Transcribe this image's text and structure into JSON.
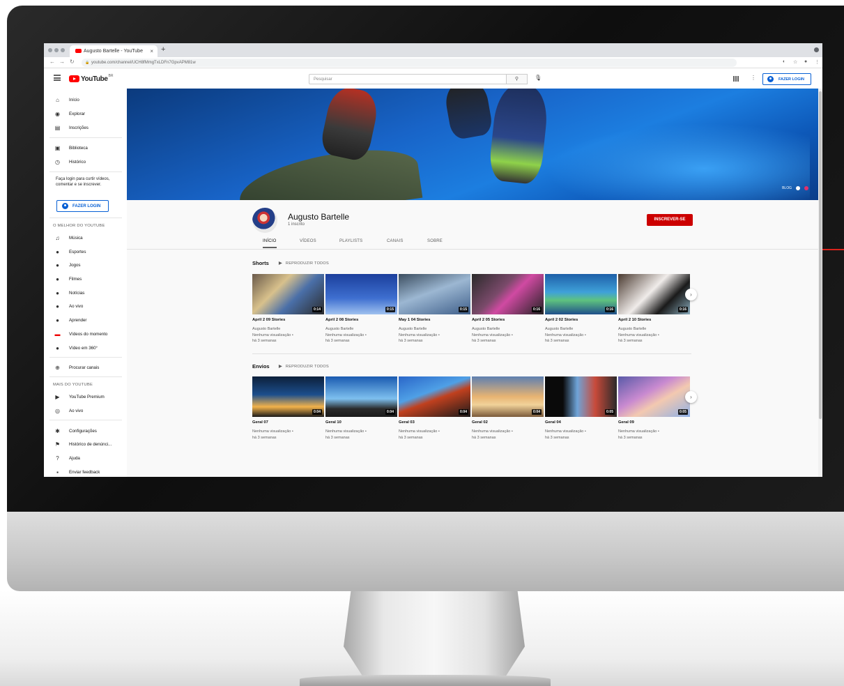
{
  "browser": {
    "tab_title": "Augusto Bartelle - YouTube",
    "tab_close": "×",
    "new_tab": "+",
    "url": "youtube.com/channel/UCH8fMmgTxLDFn7GpvAPM81w"
  },
  "header": {
    "logo_text": "YouTube",
    "logo_country": "BR",
    "search_placeholder": "Pesquisar",
    "login_label": "FAZER LOGIN"
  },
  "sidebar": {
    "main_items": [
      {
        "label": "Início",
        "icon": "home-icon"
      },
      {
        "label": "Explorar",
        "icon": "compass-icon"
      },
      {
        "label": "Inscrições",
        "icon": "subscriptions-icon"
      }
    ],
    "library_items": [
      {
        "label": "Biblioteca",
        "icon": "library-icon"
      },
      {
        "label": "Histórico",
        "icon": "history-icon"
      }
    ],
    "login_prompt": "Faça login para curtir vídeos, comentar e se inscrever.",
    "login_label": "FAZER LOGIN",
    "best_heading": "O MELHOR DO YOUTUBE",
    "best_items": [
      {
        "label": "Música",
        "icon": "music-icon"
      },
      {
        "label": "Esportes",
        "icon": "trophy-icon"
      },
      {
        "label": "Jogos",
        "icon": "gamepad-icon"
      },
      {
        "label": "Filmes",
        "icon": "film-icon"
      },
      {
        "label": "Notícias",
        "icon": "news-icon"
      },
      {
        "label": "Ao vivo",
        "icon": "live-icon"
      },
      {
        "label": "Aprender",
        "icon": "bulb-icon"
      },
      {
        "label": "Vídeos do momento",
        "icon": "trending-icon"
      },
      {
        "label": "Vídeo em 360°",
        "icon": "vr-icon"
      }
    ],
    "browse_channels": "Procurar canais",
    "more_heading": "MAIS DO YOUTUBE",
    "more_items": [
      {
        "label": "YouTube Premium",
        "icon": "premium-icon"
      },
      {
        "label": "Ao vivo",
        "icon": "broadcast-icon"
      }
    ],
    "settings_items": [
      {
        "label": "Configurações",
        "icon": "gear-icon"
      },
      {
        "label": "Histórico de denúnci...",
        "icon": "flag-icon"
      },
      {
        "label": "Ajuda",
        "icon": "help-icon"
      },
      {
        "label": "Enviar feedback",
        "icon": "feedback-icon"
      }
    ]
  },
  "banner": {
    "links_label": "BLOG"
  },
  "channel": {
    "name": "Augusto Bartelle",
    "subscribers": "1 inscrito",
    "subscribe_label": "INSCREVER-SE",
    "tabs": [
      "INÍCIO",
      "VÍDEOS",
      "PLAYLISTS",
      "CANAIS",
      "SOBRE"
    ]
  },
  "shorts": {
    "title": "Shorts",
    "play_all": "REPRODUZIR TODOS",
    "videos": [
      {
        "title": "April 2 09 Stories",
        "duration": "0:14",
        "channel": "Augusto Bartelle",
        "views": "Nenhuma visualização •",
        "age": "há 3 semanas"
      },
      {
        "title": "April 2 08 Stories",
        "duration": "0:15",
        "channel": "Augusto Bartelle",
        "views": "Nenhuma visualização •",
        "age": "há 3 semanas"
      },
      {
        "title": "May 1 04 Stories",
        "duration": "0:15",
        "channel": "Augusto Bartelle",
        "views": "Nenhuma visualização •",
        "age": "há 3 semanas"
      },
      {
        "title": "April 2 05 Stories",
        "duration": "0:16",
        "channel": "Augusto Bartelle",
        "views": "Nenhuma visualização •",
        "age": "há 3 semanas"
      },
      {
        "title": "April 2 02 Stories",
        "duration": "0:16",
        "channel": "Augusto Bartelle",
        "views": "Nenhuma visualização •",
        "age": "há 3 semanas"
      },
      {
        "title": "April 2 10 Stories",
        "duration": "0:16",
        "channel": "Augusto Bartelle",
        "views": "Nenhuma visualização •",
        "age": "há 3 semanas"
      }
    ]
  },
  "uploads": {
    "title": "Envios",
    "play_all": "REPRODUZIR TODOS",
    "videos": [
      {
        "title": "Geral 07",
        "duration": "0:04",
        "views": "Nenhuma visualização •",
        "age": "há 3 semanas"
      },
      {
        "title": "Geral 10",
        "duration": "0:04",
        "views": "Nenhuma visualização •",
        "age": "há 3 semanas"
      },
      {
        "title": "Geral 03",
        "duration": "0:04",
        "views": "Nenhuma visualização •",
        "age": "há 3 semanas"
      },
      {
        "title": "Geral 02",
        "duration": "0:04",
        "views": "Nenhuma visualização •",
        "age": "há 3 semanas"
      },
      {
        "title": "Geral 04",
        "duration": "0:05",
        "views": "Nenhuma visualização •",
        "age": "há 3 semanas"
      },
      {
        "title": "Geral 09",
        "duration": "0:05",
        "views": "Nenhuma visualização •",
        "age": "há 3 semanas"
      }
    ]
  },
  "colors": {
    "brand_red": "#cc0000",
    "link_blue": "#065fd4",
    "annotation_red": "#d9231c"
  }
}
